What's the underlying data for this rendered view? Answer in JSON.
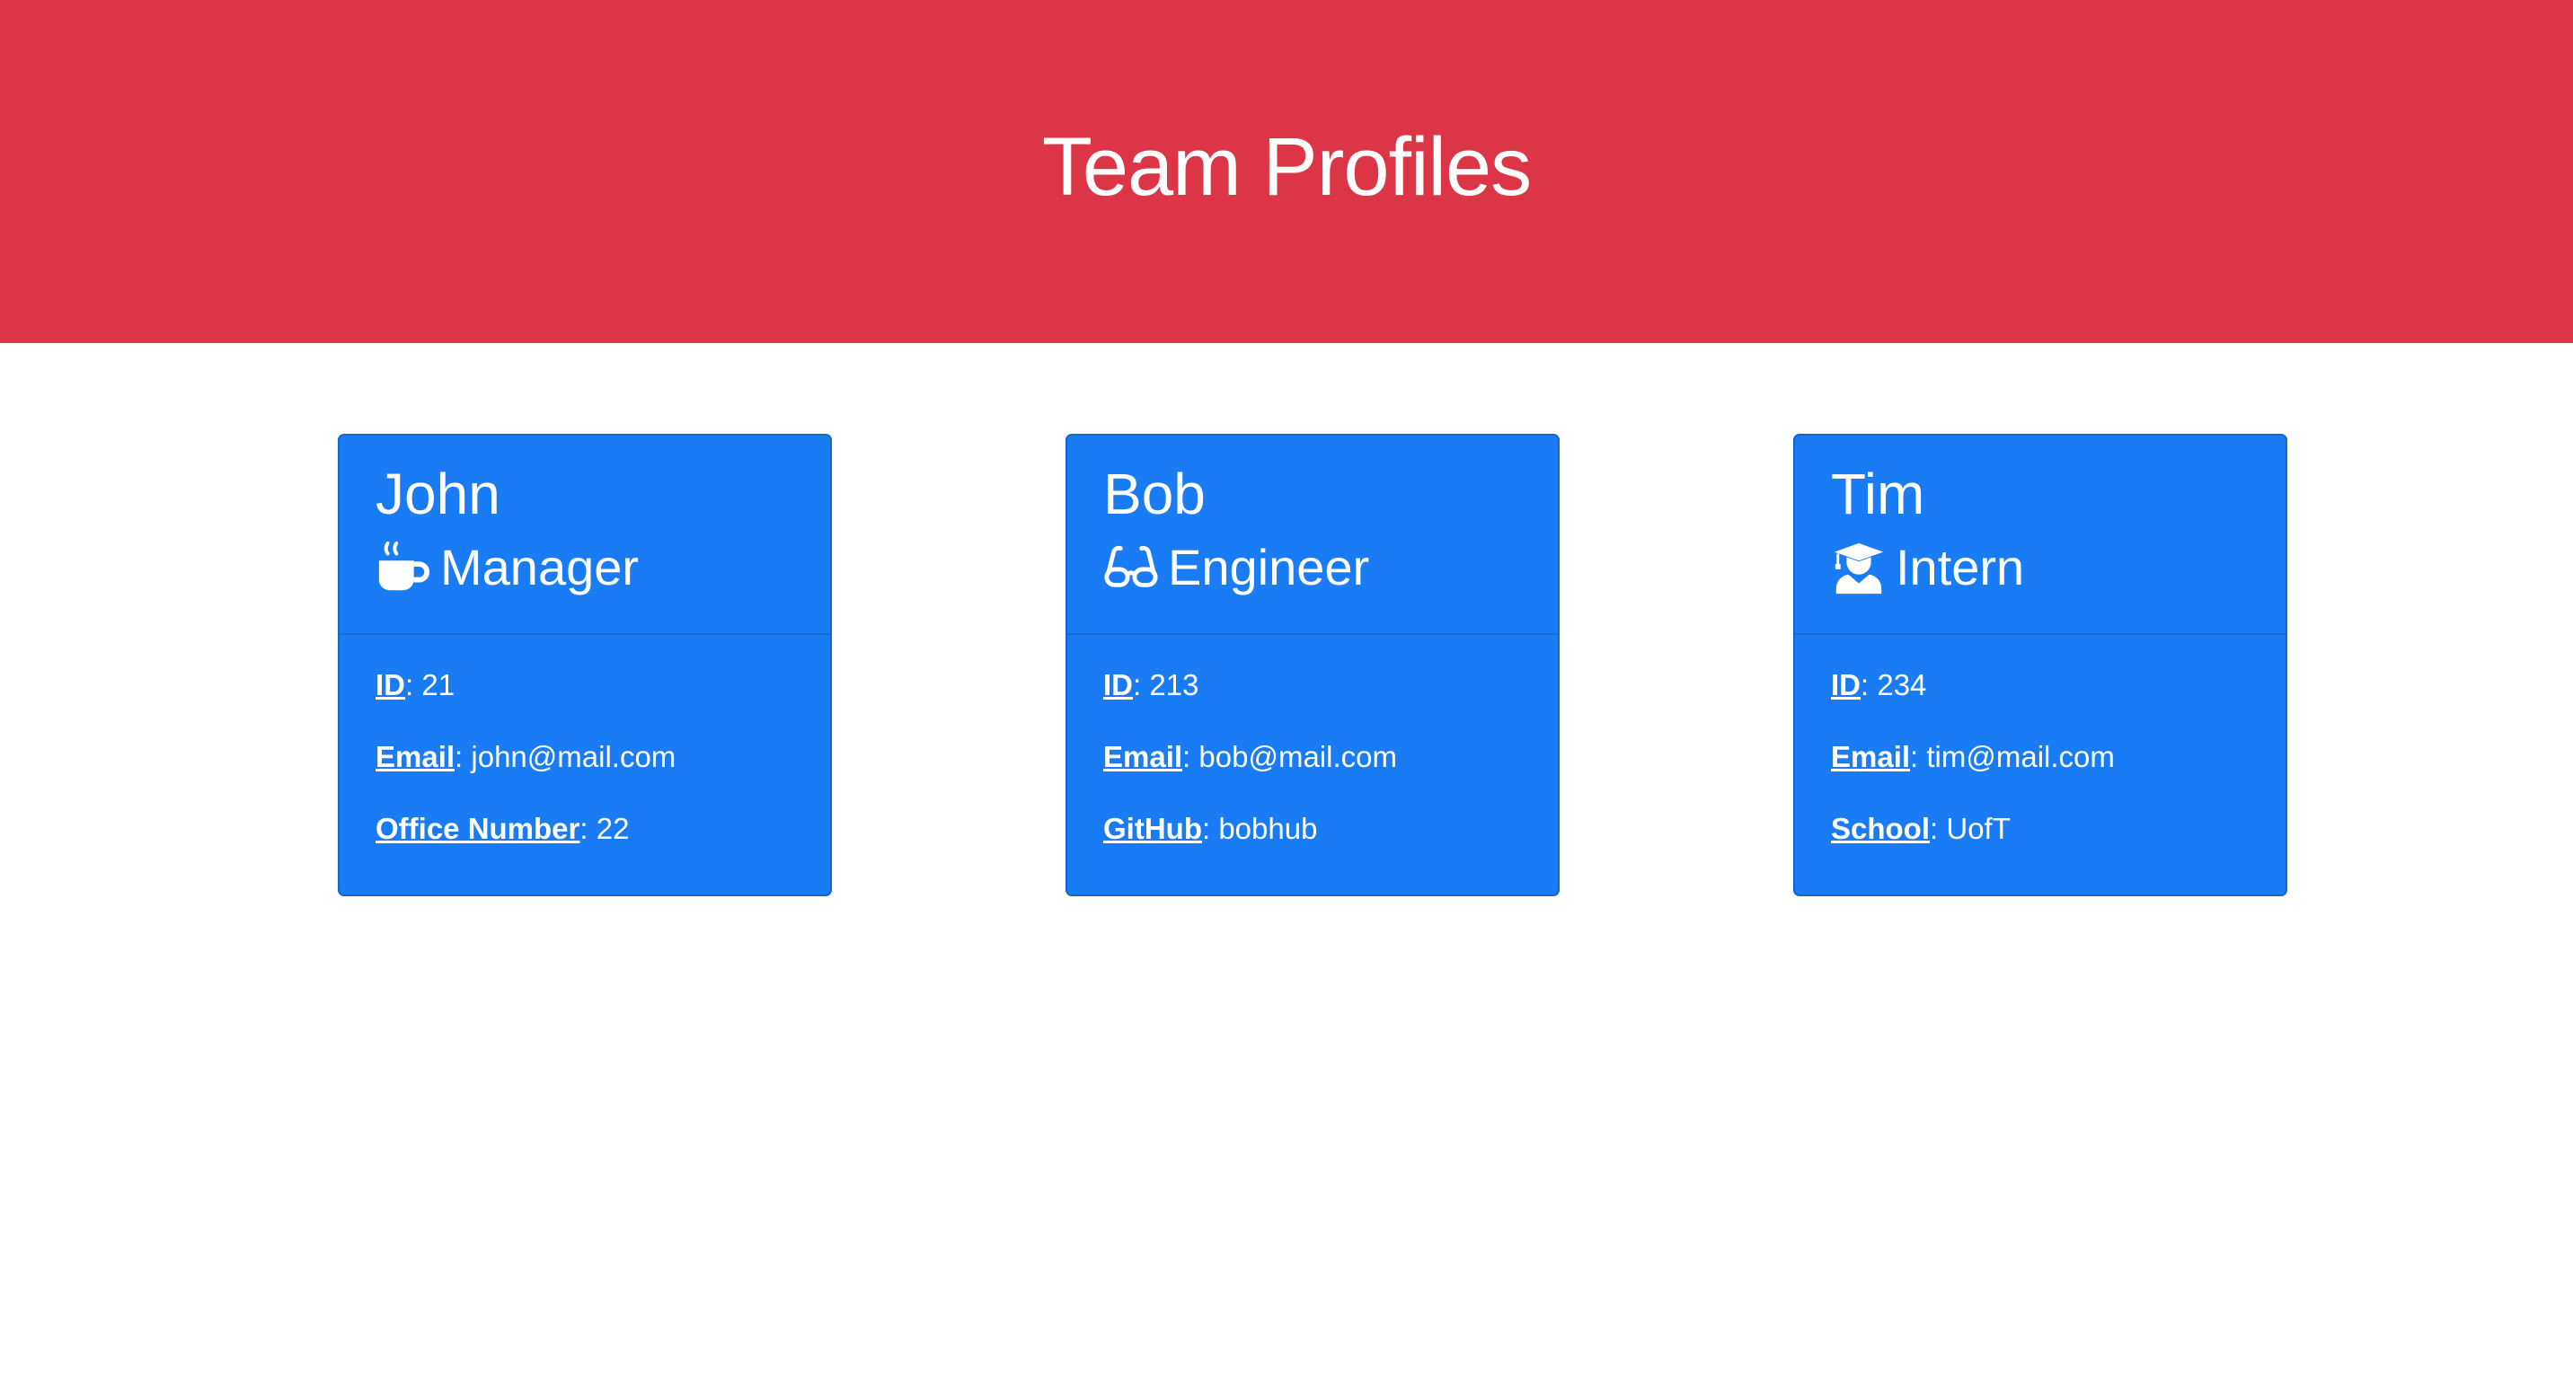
{
  "header": {
    "title": "Team Profiles"
  },
  "colors": {
    "header_bg": "#dc3545",
    "card_bg": "#1a7cf5",
    "text": "#ffffff"
  },
  "cards": [
    {
      "name": "John",
      "role": "Manager",
      "icon": "mug-hot-icon",
      "fields": [
        {
          "label": "ID",
          "value": "21"
        },
        {
          "label": "Email",
          "value": "john@mail.com"
        },
        {
          "label": "Office Number",
          "value": "22"
        }
      ]
    },
    {
      "name": "Bob",
      "role": "Engineer",
      "icon": "glasses-icon",
      "fields": [
        {
          "label": "ID",
          "value": "213"
        },
        {
          "label": "Email",
          "value": "bob@mail.com"
        },
        {
          "label": "GitHub",
          "value": "bobhub"
        }
      ]
    },
    {
      "name": "Tim",
      "role": "Intern",
      "icon": "user-graduate-icon",
      "fields": [
        {
          "label": "ID",
          "value": "234"
        },
        {
          "label": "Email",
          "value": "tim@mail.com"
        },
        {
          "label": "School",
          "value": "UofT"
        }
      ]
    }
  ]
}
